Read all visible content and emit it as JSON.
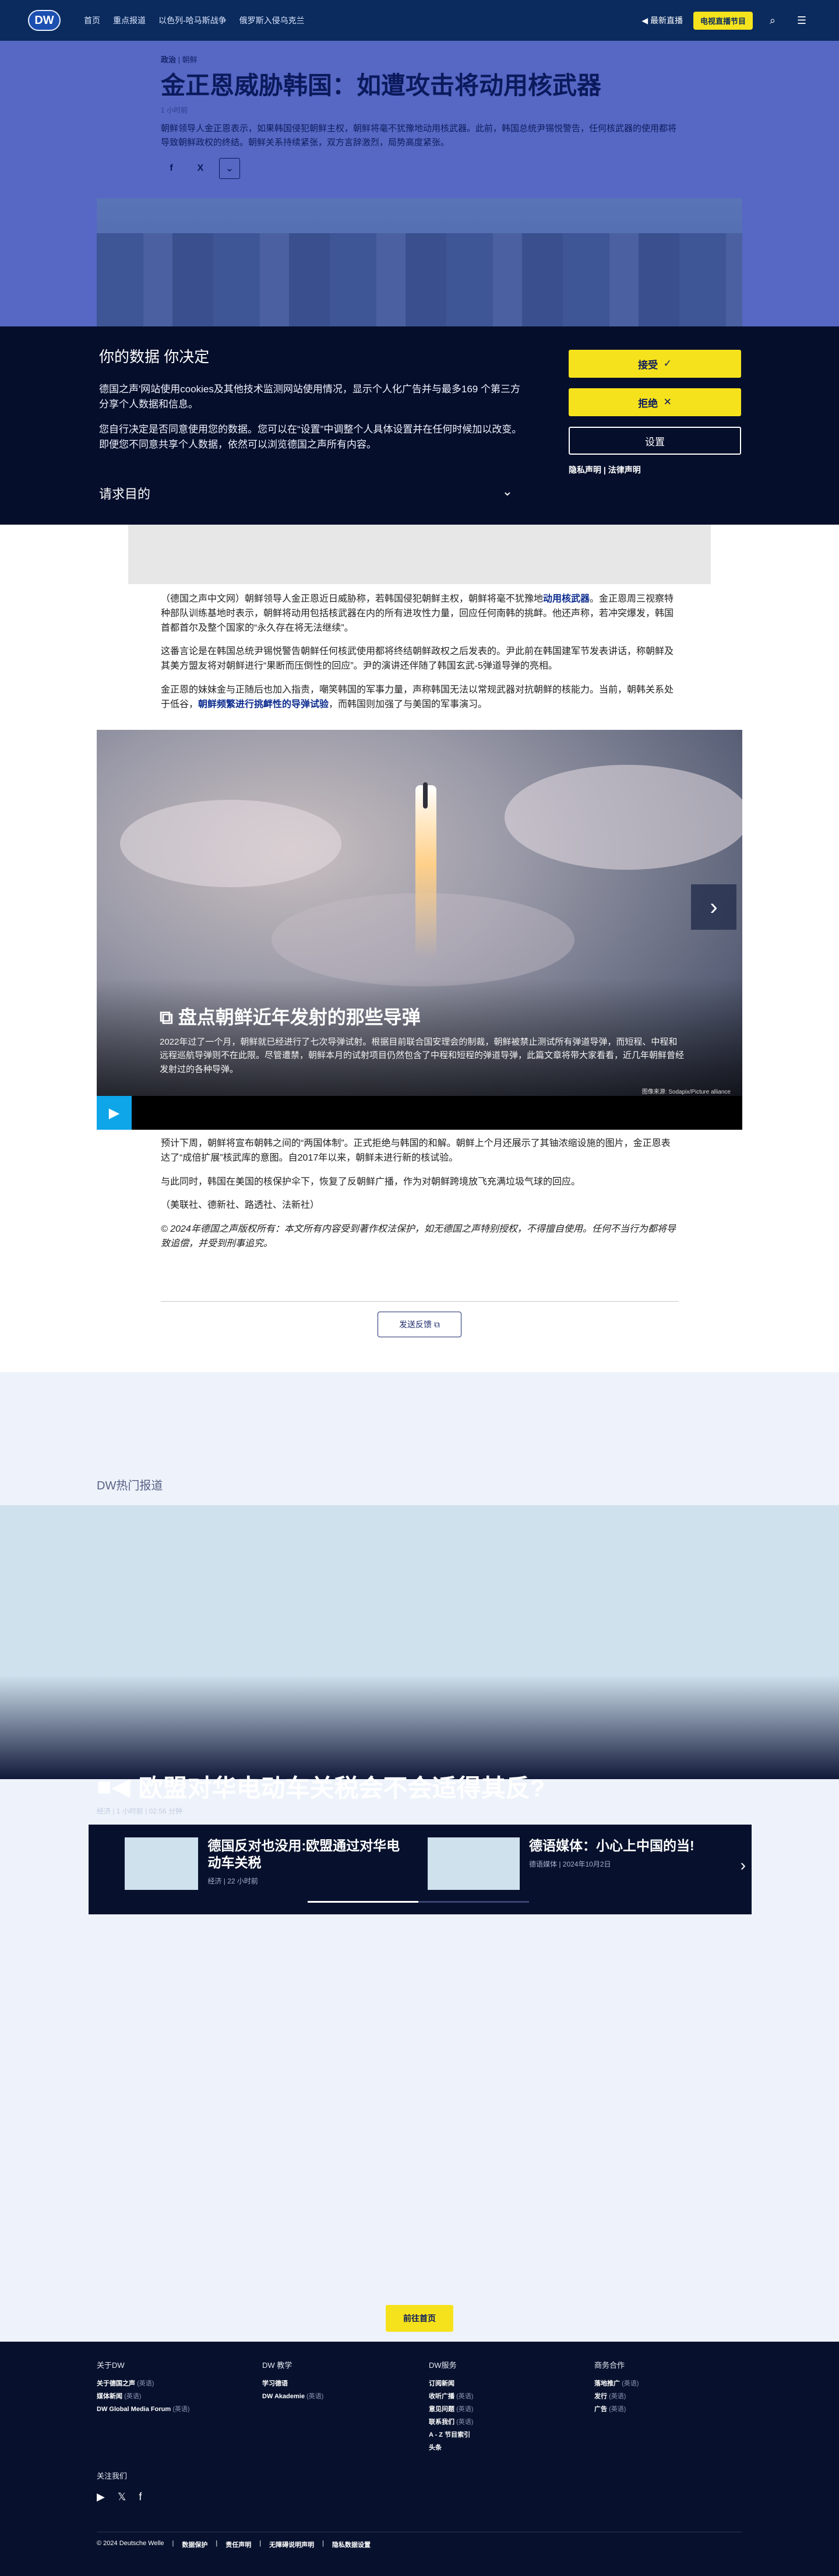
{
  "header": {
    "logo": "DW",
    "nav": [
      "首页",
      "重点报道",
      "以色列-哈马斯战争",
      "俄罗斯入侵乌克兰"
    ],
    "live_label": "最新直播",
    "live_tv": "电视直播节目",
    "search_icon": "search-icon",
    "menu_icon": "hamburger-menu-icon"
  },
  "article": {
    "crumb_section": "政治",
    "crumb_sub": "朝鲜",
    "title": "金正恩威胁韩国：如遭攻击将动用核武器",
    "time": "1 小时前",
    "lede": "朝鲜领导人金正恩表示，如果韩国侵犯朝鲜主权，朝鲜将毫不犹豫地动用核武器。此前，韩国总统尹锡悦警告，任何核武器的使用都将导致朝鲜政权的终结。朝鲜关系持续紧张，双方言辞激烈，局势高度紧张。",
    "share": [
      "f",
      "X"
    ],
    "body_p1_a": "（德国之声中文网）朝鲜领导人金正恩近日威胁称，若韩国侵犯朝鲜主权，朝鲜将毫不犹豫地",
    "body_p1_link": "动用核武器",
    "body_p1_b": "。金正恩周三视察特种部队训练基地时表示，朝鲜将动用包括核武器在内的所有进攻性力量，回应任何南韩的挑衅。他还声称，若冲突爆发，韩国首都首尔及整个国家的“永久存在将无法继续”。",
    "body_p2": "这番言论是在韩国总统尹锡悦警告朝鲜任何核武使用都将终结朝鲜政权之后发表的。尹此前在韩国建军节发表讲话，称朝鲜及其美方盟友将对朝鲜进行“果断而压倒性的回应”。尹的演讲还伴随了韩国玄武-5弹道导弹的亮相。",
    "body_p3_a": "金正恩的妹妹金与正随后也加入指责，嘲笑韩国的军事力量，声称韩国无法以常规武器对抗朝鲜的核能力。当前，朝韩关系处于低谷，",
    "body_p3_link": "朝鲜频繁进行挑衅性的导弹试验",
    "body_p3_b": "，而韩国则加强了与美国的军事演习。",
    "body_p4": "预计下周，朝鲜将宣布朝韩之间的“两国体制”。正式拒绝与韩国的和解。朝鲜上个月还展示了其铀浓缩设施的图片，金正恩表达了“成倍扩展”核武库的意图。自2017年以来，朝鲜未进行新的核试验。",
    "body_p5": "与此同时，韩国在美国的核保护伞下，恢复了反朝鲜广播，作为对朝鲜跨境放飞充满垃圾气球的回应。",
    "sources": "（美联社、德新社、路透社、法新社）",
    "copyright": "© 2024年德国之声版权所有：本文所有内容受到著作权法保护，如无德国之声特别授权，不得擅自使用。任何不当行为都将导致追偿，并受到刑事追究。",
    "feedback": "发送反馈"
  },
  "gallery": {
    "icon": "gallery-icon",
    "title": "盘点朝鲜近年发射的那些导弹",
    "text": "2022年过了一个月，朝鲜就已经进行了七次导弹试射。根据目前联合国安理会的制裁，朝鲜被禁止测试所有弹道导弹，而短程、中程和远程巡航导弹则不在此限。尽管遭禁，朝鲜本月的试射项目仍然包含了中程和短程的弹道导弹，此篇文章将带大家看看，近几年朝鲜曾经发射过的各种导弹。",
    "credit": "图像来源: Sodapix/Picture alliance",
    "next_icon": "chevron-right-icon",
    "play_icon": "play-icon"
  },
  "cookie": {
    "title": "你的数据 你决定",
    "p1": "德国之声'网站使用cookies及其他技术监测网站使用情况，显示个人化广告并与最多169 个第三方分享个人数据和信息。",
    "p2": "您自行决定是否同意使用您的数据。您可以在“设置”中调整个人具体设置并在任何时候加以改变。即便您不同意共享个人数据，依然可以浏览德国之声所有内容。",
    "purpose": "请求目的",
    "accept": "接受",
    "reject": "拒绝",
    "settings": "设置",
    "privacy": "隐私声明",
    "legal": "法律声明"
  },
  "trending": {
    "label": "DW热门报道",
    "feature_title": "欧盟对华电动车关税会不会适得其反?",
    "feature_meta": "经济 | 1 小时前 | 02:56 分钟",
    "cards": [
      {
        "title": "德国反对也没用:欧盟通过对华电动车关税",
        "meta": "经济 | 22 小时前"
      },
      {
        "title": "德语媒体：小心上中国的当!",
        "meta": "德语媒体 | 2024年10月2日"
      }
    ],
    "more": "前往首页"
  },
  "footer": {
    "cols": [
      {
        "head": "关于DW",
        "items": [
          [
            "关于德国之声",
            "(英语)"
          ],
          [
            "媒体新闻",
            "(英语)"
          ],
          [
            "DW Global Media Forum",
            "(英语)"
          ]
        ]
      },
      {
        "head": "DW 教学",
        "items": [
          [
            "学习德语",
            ""
          ],
          [
            "DW Akademie",
            "(英语)"
          ]
        ]
      },
      {
        "head": "DW服务",
        "items": [
          [
            "订阅新闻",
            ""
          ],
          [
            "收听广播",
            "(英语)"
          ],
          [
            "意见问题",
            "(英语)"
          ],
          [
            "联系我们",
            "(英语)"
          ],
          [
            "A - Z 节目索引",
            ""
          ],
          [
            "头条",
            ""
          ]
        ]
      },
      {
        "head": "商务合作",
        "items": [
          [
            "落地推广",
            "(英语)"
          ],
          [
            "发行",
            "(英语)"
          ],
          [
            "广告",
            "(英语)"
          ]
        ]
      }
    ],
    "follow": "关注我们",
    "social": [
      "youtube-icon",
      "x-icon",
      "facebook-icon"
    ],
    "copyright": "© 2024 Deutsche Welle",
    "links": [
      "数据保护",
      "责任声明",
      "无障碍说明声明",
      "隐私数据设置"
    ]
  }
}
